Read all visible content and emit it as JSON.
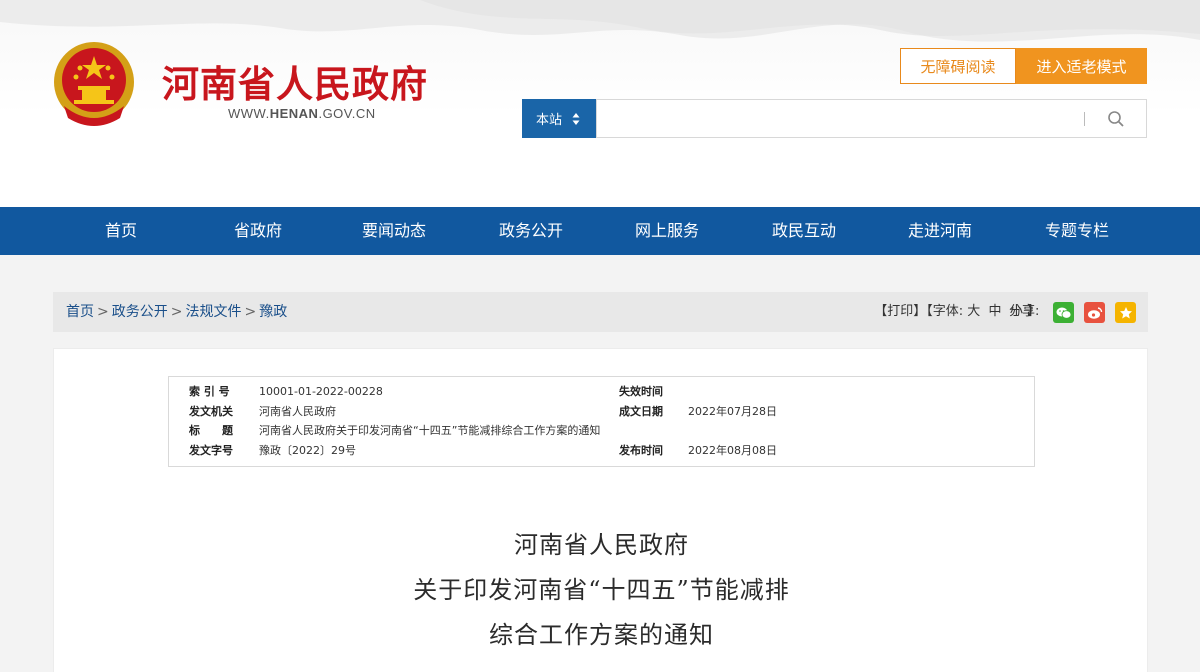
{
  "header": {
    "site_name": "河南省人民政府",
    "site_url_prefix": "WWW.",
    "site_url_main": "HENAN",
    "site_url_suffix": ".GOV.CN",
    "accessibility_label": "无障碍阅读",
    "elder_mode_label": "进入适老模式",
    "search": {
      "scope": "本站",
      "value": "",
      "placeholder": ""
    }
  },
  "nav": {
    "items": [
      "首页",
      "省政府",
      "要闻动态",
      "政务公开",
      "网上服务",
      "政民互动",
      "走进河南",
      "专题专栏"
    ]
  },
  "breadcrumb": {
    "items": [
      "首页",
      "政务公开",
      "法规文件",
      "豫政"
    ],
    "separator": ">"
  },
  "tools": {
    "print_label": "【打印】",
    "font_prefix": "【字体:",
    "font_large": "大",
    "font_medium": "中",
    "font_small": "小",
    "font_suffix": "】",
    "share_label": "分享:"
  },
  "meta": {
    "index_label": "索 引 号",
    "index_value": "10001-01-2022-00228",
    "expire_label": "失效时间",
    "expire_value": "",
    "issuer_label": "发文机关",
    "issuer_value": "河南省人民政府",
    "date_written_label": "成文日期",
    "date_written_value": "2022年07月28日",
    "title_label": "标　　题",
    "title_value": "河南省人民政府关于印发河南省“十四五”节能减排综合工作方案的通知",
    "doc_no_label": "发文字号",
    "doc_no_value": "豫政〔2022〕29号",
    "published_label": "发布时间",
    "published_value": "2022年08月08日"
  },
  "document": {
    "title_line1": "河南省人民政府",
    "title_line2": "关于印发河南省“十四五”节能减排",
    "title_line3": "综合工作方案的通知"
  },
  "colors": {
    "brand_red": "#c8161d",
    "nav_blue": "#11589f",
    "accent_orange": "#f0941f",
    "search_blue": "#1a65a8"
  }
}
